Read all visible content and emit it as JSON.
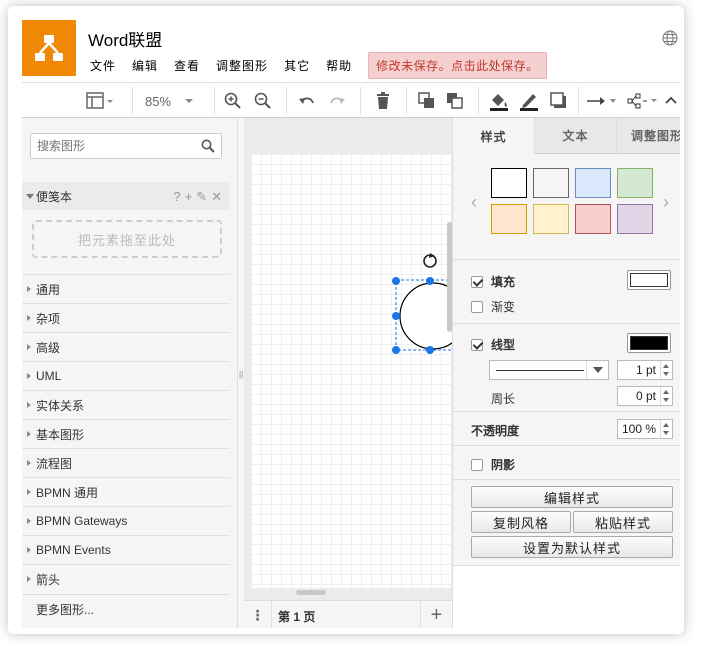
{
  "app": {
    "title": "Word联盟",
    "menu": [
      "文件",
      "编辑",
      "查看",
      "调整图形",
      "其它",
      "帮助"
    ],
    "unsaved_notice": "修改未保存。点击此处保存。"
  },
  "toolbar": {
    "zoom": "85%",
    "icons": [
      "page-view-icon",
      "zoom-in-icon",
      "zoom-out-icon",
      "undo-icon",
      "redo-icon",
      "delete-icon",
      "to-front-icon",
      "to-back-icon",
      "fill-color-icon",
      "line-color-icon",
      "shadow-icon",
      "connection-arrow-icon",
      "waypoints-icon",
      "collapse-icon"
    ]
  },
  "sidebar": {
    "search_placeholder": "搜索图形",
    "scratchpad_label": "便笺本",
    "scratchpad_tools": [
      "?",
      "+",
      "✎",
      "✕"
    ],
    "drop_hint": "把元素拖至此处",
    "categories": [
      "通用",
      "杂项",
      "高级",
      "UML",
      "实体关系",
      "基本图形",
      "流程图",
      "BPMN 通用",
      "BPMN Gateways",
      "BPMN Events",
      "箭头"
    ],
    "more_shapes": "更多图形..."
  },
  "canvas": {
    "page_label": "第 1 页",
    "page_menu": "⋮",
    "add_page": "+"
  },
  "format": {
    "tabs": [
      "样式",
      "文本",
      "调整图形"
    ],
    "style_swatches": [
      {
        "fill": "#ffffff",
        "stroke": "#000000"
      },
      {
        "fill": "#f5f5f5",
        "stroke": "#666666"
      },
      {
        "fill": "#dae8fc",
        "stroke": "#6c8ebf"
      },
      {
        "fill": "#d5e8d4",
        "stroke": "#82b366"
      },
      {
        "fill": "#ffe6cc",
        "stroke": "#d79b00"
      },
      {
        "fill": "#fff2cc",
        "stroke": "#d6b656"
      },
      {
        "fill": "#f8cecc",
        "stroke": "#b85450"
      },
      {
        "fill": "#e1d5e7",
        "stroke": "#9673a6"
      }
    ],
    "fill_label": "填充",
    "gradient_label": "渐变",
    "line_label": "线型",
    "perimeter_label": "周长",
    "line_width": "1 pt",
    "perimeter_value": "0 pt",
    "opacity_label": "不透明度",
    "opacity_value": "100 %",
    "shadow_label": "阴影",
    "edit_style": "编辑样式",
    "copy_style": "复制风格",
    "paste_style": "粘贴样式",
    "set_default": "设置为默认样式",
    "fill_color": "#ffffff",
    "line_color": "#000000",
    "fill_checked": true,
    "gradient_checked": false,
    "line_checked": true,
    "shadow_checked": false
  },
  "colors": {
    "brand": "#f08705",
    "selection": "#1a73e8",
    "unsaved_bg": "#f5d0d0",
    "unsaved_text": "#c0392b"
  }
}
